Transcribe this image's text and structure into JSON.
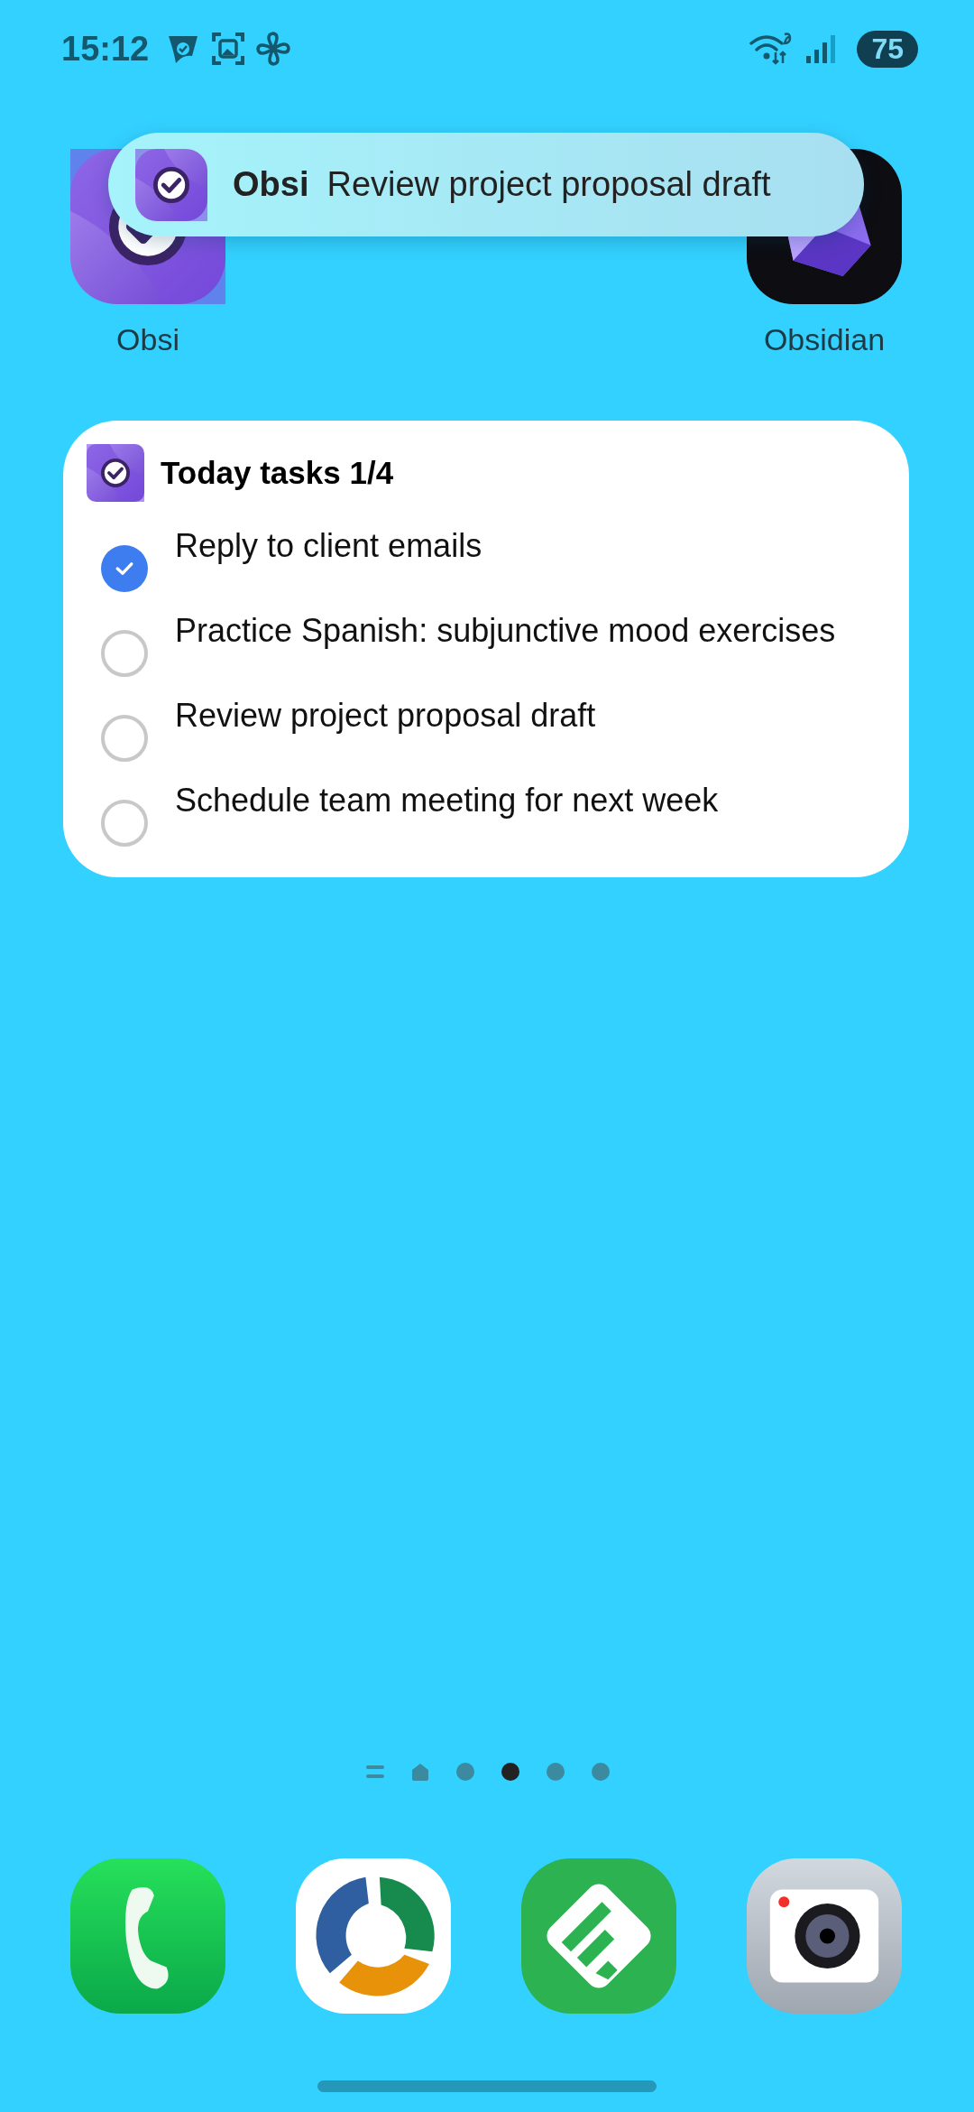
{
  "status_bar": {
    "time": "15:12",
    "battery": "75"
  },
  "notification": {
    "app": "Obsi",
    "text": "Review project proposal draft"
  },
  "home_icons": [
    {
      "kind": "obsi",
      "label": "Obsi"
    },
    {
      "kind": "obsidian",
      "label": "Obsidian"
    }
  ],
  "widget": {
    "title": "Today tasks 1/4",
    "tasks": [
      {
        "text": "Reply to client emails",
        "checked": true
      },
      {
        "text": "Practice Spanish: subjunctive mood exercises",
        "checked": false
      },
      {
        "text": "Review project proposal draft",
        "checked": false
      },
      {
        "text": "Schedule team meeting for next week",
        "checked": false
      }
    ]
  },
  "page_indicator": [
    {
      "kind": "menu",
      "selected": false
    },
    {
      "kind": "home",
      "selected": false
    },
    {
      "kind": "page",
      "selected": false
    },
    {
      "kind": "page",
      "selected": true
    },
    {
      "kind": "page",
      "selected": false
    },
    {
      "kind": "page",
      "selected": false
    }
  ],
  "dock": [
    {
      "kind": "phone"
    },
    {
      "kind": "sync"
    },
    {
      "kind": "feed"
    },
    {
      "kind": "camera"
    }
  ]
}
